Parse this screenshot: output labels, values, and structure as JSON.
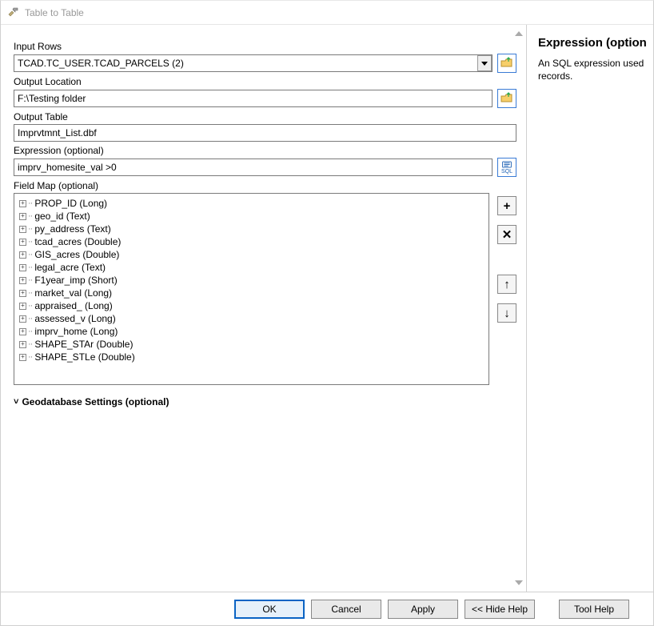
{
  "window": {
    "title": "Table to Table"
  },
  "inputRows": {
    "label": "Input Rows",
    "value": "TCAD.TC_USER.TCAD_PARCELS (2)"
  },
  "outputLocation": {
    "label": "Output Location",
    "value": "F:\\Testing folder"
  },
  "outputTable": {
    "label": "Output Table",
    "value": "Imprvtmnt_List.dbf"
  },
  "expression": {
    "label": "Expression (optional)",
    "value": "imprv_homesite_val >0"
  },
  "fieldMap": {
    "label": "Field Map (optional)",
    "items": [
      "PROP_ID (Long)",
      "geo_id (Text)",
      "py_address (Text)",
      "tcad_acres (Double)",
      "GIS_acres (Double)",
      "legal_acre (Text)",
      "F1year_imp (Short)",
      "market_val (Long)",
      "appraised_ (Long)",
      "assessed_v (Long)",
      "imprv_home (Long)",
      "SHAPE_STAr (Double)",
      "SHAPE_STLe (Double)"
    ]
  },
  "geoSettings": {
    "label": "Geodatabase Settings (optional)"
  },
  "help": {
    "title": "Expression (option",
    "body": "An SQL expression used records."
  },
  "buttons": {
    "ok": "OK",
    "cancel": "Cancel",
    "apply": "Apply",
    "hideHelp": "<< Hide Help",
    "toolHelp": "Tool Help"
  },
  "sqlButton": {
    "label": "SQL"
  }
}
